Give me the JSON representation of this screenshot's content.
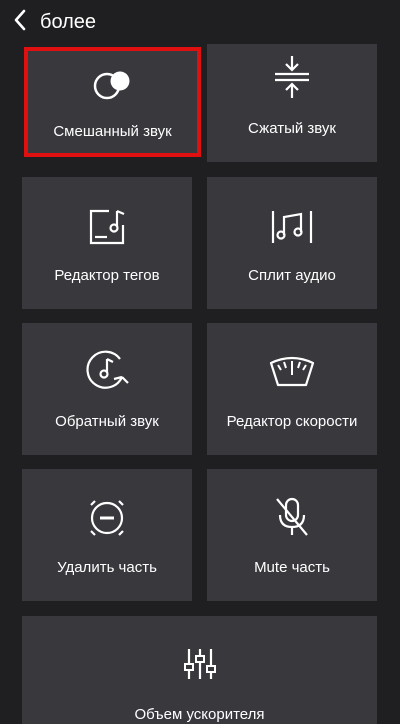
{
  "header": {
    "title": "более",
    "back_icon": "chevron-left-icon"
  },
  "tiles": [
    {
      "label": "Смешанный звук",
      "icon": "mix-circles-icon",
      "selected": true
    },
    {
      "label": "Сжатый звук",
      "icon": "compress-arrows-icon",
      "selected": false
    },
    {
      "label": "Редактор тегов",
      "icon": "tag-editor-icon",
      "selected": false
    },
    {
      "label": "Сплит аудио",
      "icon": "split-audio-icon",
      "selected": false
    },
    {
      "label": "Обратный звук",
      "icon": "reverse-audio-icon",
      "selected": false
    },
    {
      "label": "Редактор скорости",
      "icon": "speedometer-icon",
      "selected": false
    },
    {
      "label": "Удалить часть",
      "icon": "remove-part-icon",
      "selected": false
    },
    {
      "label": "Mute часть",
      "icon": "mic-mute-icon",
      "selected": false
    },
    {
      "label": "Объем ускорителя",
      "icon": "equalizer-sliders-icon",
      "selected": false
    }
  ],
  "colors": {
    "background": "#1f1f22",
    "tile": "#38383d",
    "selection_border": "#e01010",
    "text": "#ffffff"
  }
}
